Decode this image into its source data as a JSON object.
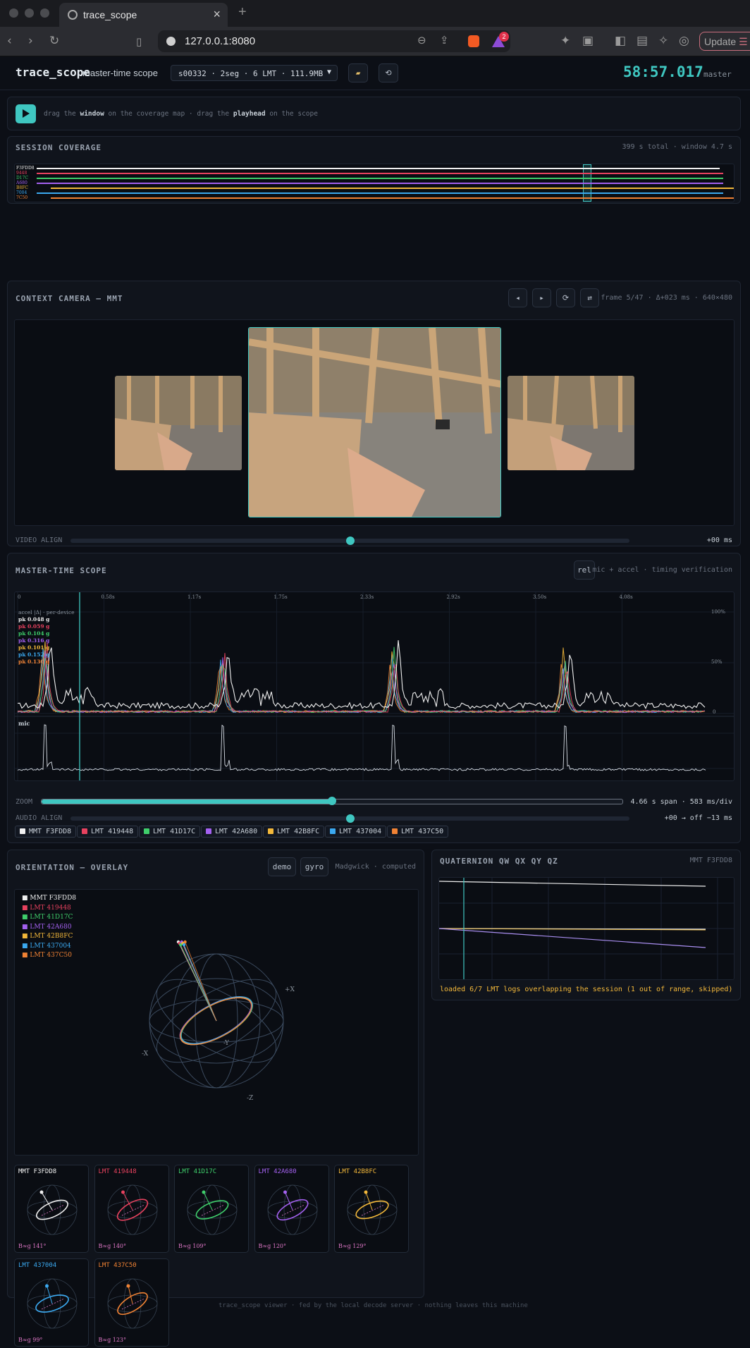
{
  "browser": {
    "tab_title": "trace_scope",
    "url": "127.0.0.1:8080",
    "update_label": "Update",
    "notify_count": "2"
  },
  "header": {
    "app_name": "trace_scope",
    "subtitle": "master-time scope",
    "session_select": "s00332 · 2seg · 6 LMT · 111.9MB",
    "clock": "58:57.017",
    "clock_label": "master"
  },
  "hint": {
    "text_1": "drag the ",
    "bold_1": "window",
    "text_2": " on the coverage map · drag the ",
    "bold_2": "playhead",
    "text_3": " on the scope"
  },
  "coverage": {
    "title": "SESSION COVERAGE",
    "meta": "399 s total · window 4.7 s",
    "rows": [
      {
        "label": "F3FDD8",
        "color": "#f0f0f0",
        "start": 0.03,
        "end": 0.98
      },
      {
        "label": "9448",
        "color": "#e8425f",
        "start": 0.03,
        "end": 0.985
      },
      {
        "label": "D17C",
        "color": "#3fce6b",
        "start": 0.03,
        "end": 0.985
      },
      {
        "label": "A680",
        "color": "#a461f0",
        "start": 0.03,
        "end": 0.985
      },
      {
        "label": "B8FC",
        "color": "#f3b83a",
        "start": 0.05,
        "end": 1.0
      },
      {
        "label": "7004",
        "color": "#3ba9f0",
        "start": 0.03,
        "end": 0.985
      },
      {
        "label": "7C50",
        "color": "#f08234",
        "start": 0.05,
        "end": 1.0
      }
    ],
    "window_pos": 0.79
  },
  "camera": {
    "title": "CONTEXT CAMERA — MMT",
    "meta": "frame 5/47 · Δ+023 ms · 640×480",
    "prev_label": "◂",
    "next_label": "▸",
    "reset_label": "⟳",
    "swap_label": "⇄",
    "align_label": "VIDEO ALIGN",
    "align_value": "+00 ms",
    "align_pos": 0.5
  },
  "scope": {
    "title": "MASTER-TIME SCOPE",
    "rel_label": "rel",
    "meta": "mic + accel · timing verification",
    "ticks": [
      "0",
      "0.58s",
      "1.17s",
      "1.75s",
      "2.33s",
      "2.92s",
      "3.50s",
      "4.08s"
    ],
    "pct_labels": [
      "100%",
      "50%",
      "0"
    ],
    "accel_label": "accel |Δ| · per-device",
    "peaks": [
      {
        "text": "pk 0.048 g",
        "color": "#f0f0f0"
      },
      {
        "text": "pk 0.059 g",
        "color": "#e8425f"
      },
      {
        "text": "pk 0.104 g",
        "color": "#3fce6b"
      },
      {
        "text": "pk 0.316 g",
        "color": "#a461f0"
      },
      {
        "text": "pk 0.101 g",
        "color": "#f3b83a"
      },
      {
        "text": "pk 0.152 g",
        "color": "#3ba9f0"
      },
      {
        "text": "pk 0.130 g",
        "color": "#f08234"
      }
    ],
    "mic_label": "mic",
    "zoom_label": "ZOOM",
    "zoom_value": "4.66 s span · 583 ms/div",
    "zoom_pos": 0.5,
    "audio_label": "AUDIO ALIGN",
    "audio_value": "+00 → off −13 ms",
    "audio_pos": 0.5
  },
  "devices": [
    {
      "name": "MMT F3FDD8",
      "color": "#f0f0f0",
      "beta": "B≈g 141°"
    },
    {
      "name": "LMT 419448",
      "color": "#e8425f",
      "beta": "B≈g 140°"
    },
    {
      "name": "LMT 41D17C",
      "color": "#3fce6b",
      "beta": "B≈g 109°"
    },
    {
      "name": "LMT 42A680",
      "color": "#a461f0",
      "beta": "B≈g 120°"
    },
    {
      "name": "LMT 42B8FC",
      "color": "#f3b83a",
      "beta": "B≈g 129°"
    },
    {
      "name": "LMT 437004",
      "color": "#3ba9f0",
      "beta": "B≈g 99°"
    },
    {
      "name": "LMT 437C50",
      "color": "#f08234",
      "beta": "B≈g 123°"
    }
  ],
  "orientation": {
    "title": "ORIENTATION — OVERLAY",
    "demo_label": "demo",
    "gyro_label": "gyro",
    "meta": "Madgwick · computed",
    "axis_labels": [
      "+X",
      "-X",
      "-Y",
      "-Z"
    ]
  },
  "quaternion": {
    "title": "QUATERNION QW QX QY QZ",
    "meta": "MMT F3FDD8",
    "status": "loaded 6/7 LMT logs overlapping the session (1 out of range, skipped)"
  },
  "footer": {
    "text": "trace_scope viewer · fed by the local decode server · nothing leaves this machine"
  },
  "colors": {
    "accent": "#3fc7c1",
    "warn": "#f3b83a"
  }
}
